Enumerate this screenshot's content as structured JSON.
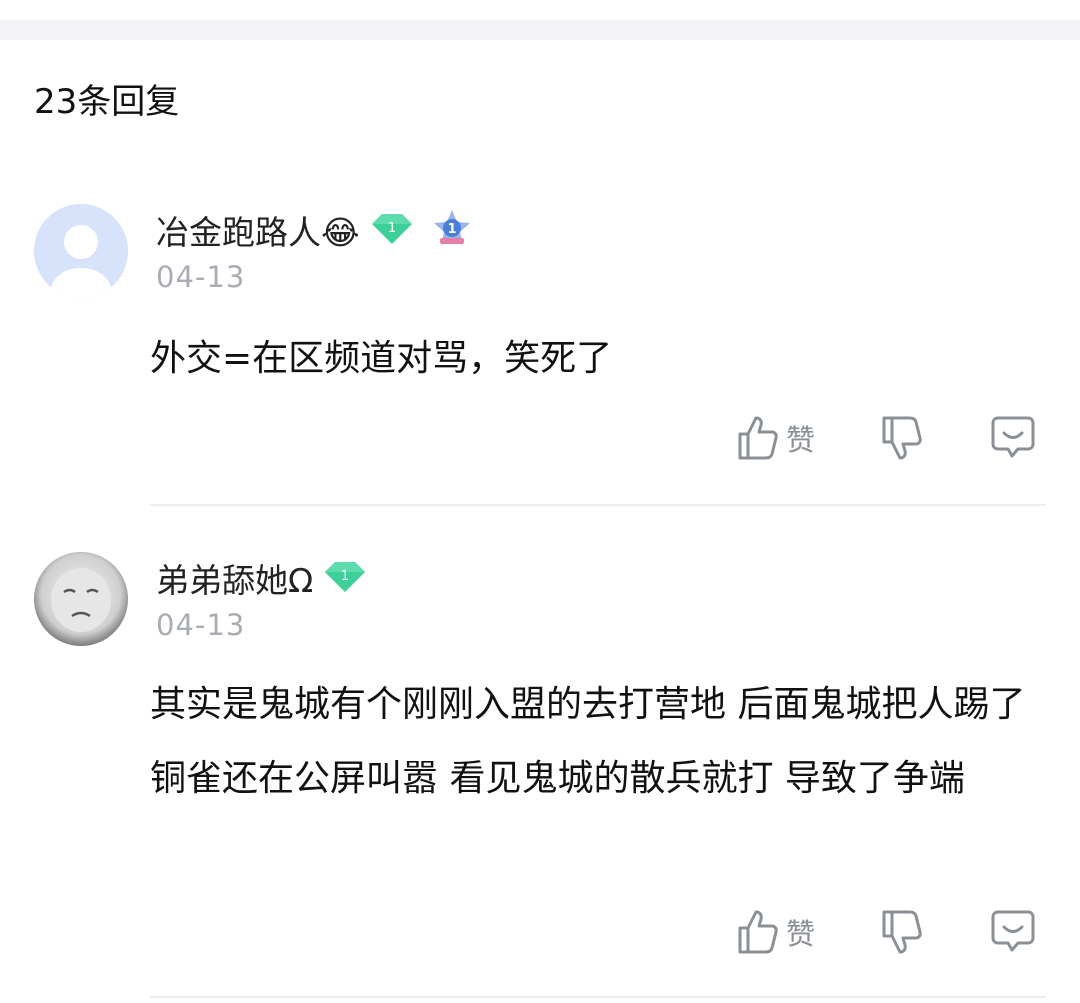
{
  "header": {
    "reply_count_label": "23条回复"
  },
  "comments": [
    {
      "username": "冶金跑路人😂",
      "level_badge": "1",
      "rank_badge": "1",
      "date": "04-13",
      "text": "外交=在区频道对骂，笑死了",
      "like_label": "赞"
    },
    {
      "username": "弟弟舔她Ω",
      "level_badge": "1",
      "date": "04-13",
      "text": "其实是鬼城有个刚刚入盟的去打营地 后面鬼城把人踢了 铜雀还在公屏叫嚣 看见鬼城的散兵就打 导致了争端",
      "like_label": "赞"
    }
  ],
  "colors": {
    "level_badge": "#3ecf9b",
    "rank_badge": "#4a7fd8",
    "muted": "#a9adb3",
    "icon": "#8b8f96"
  }
}
